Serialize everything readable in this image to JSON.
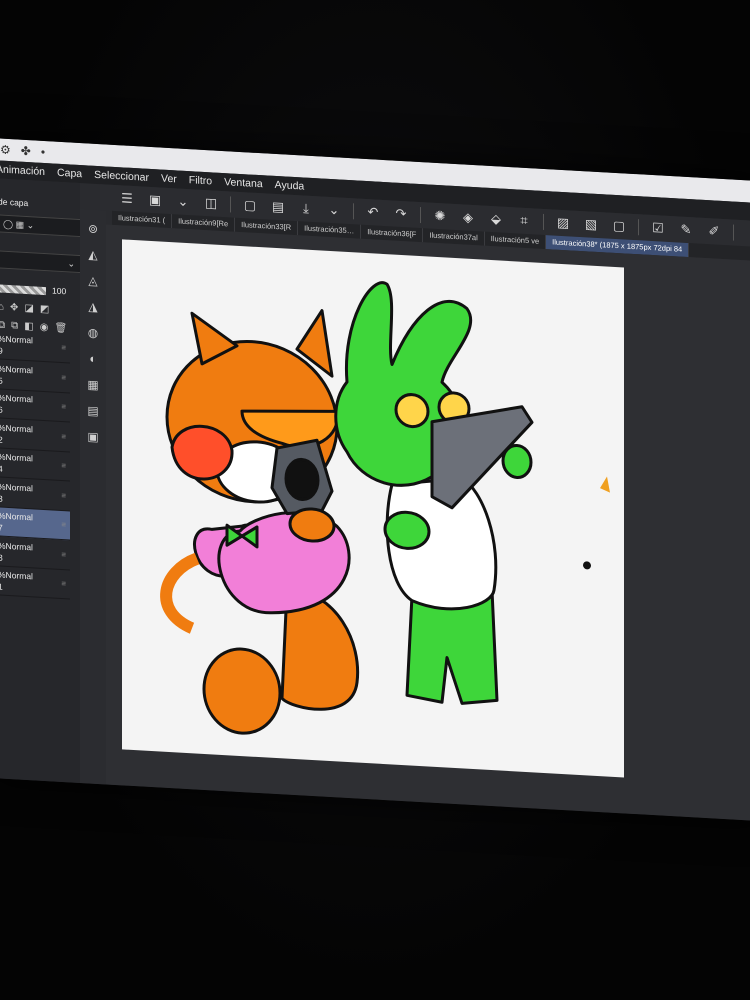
{
  "menu": {
    "items": [
      "Animación",
      "Capa",
      "Seleccionar",
      "Ver",
      "Filtro",
      "Ventana",
      "Ayuda"
    ]
  },
  "tabs": [
    {
      "label": "Ilustración31 ("
    },
    {
      "label": "Ilustración9[Re"
    },
    {
      "label": "Ilustración33[R"
    },
    {
      "label": "Ilustración35…"
    },
    {
      "label": "Ilustración36[F"
    },
    {
      "label": "Ilustración37al"
    },
    {
      "label": "Ilustración5 ve"
    },
    {
      "label": "Ilustración38* (1875 x 1875px 72dpi 84"
    }
  ],
  "layer_panel": {
    "title": "de capa",
    "opacity": "100"
  },
  "layers": [
    {
      "mode": "%Normal",
      "name": "9"
    },
    {
      "mode": "%Normal",
      "name": "5"
    },
    {
      "mode": "%Normal",
      "name": "6"
    },
    {
      "mode": "%Normal",
      "name": "2"
    },
    {
      "mode": "%Normal",
      "name": "4"
    },
    {
      "mode": "%Normal",
      "name": "3"
    },
    {
      "mode": "%Normal",
      "name": "7"
    },
    {
      "mode": "%Normal",
      "name": "8"
    },
    {
      "mode": "%Normal",
      "name": "1"
    }
  ],
  "colors": {
    "accent_selected": "#56678d",
    "active_tab": "#3d4f75",
    "tiger_orange": "#f07c10",
    "bunny_green": "#3ed63a",
    "shirt_pink": "#f27fd8"
  },
  "icons": {
    "toolbar": [
      "menu-icon",
      "select-icon",
      "chevron-down-icon",
      "transform-icon",
      "new-icon",
      "open-icon",
      "save-icon",
      "undo-icon",
      "redo-icon",
      "spinner-icon",
      "fill-icon",
      "crop-icon",
      "pen-icon",
      "brush-icon",
      "tablet-icon"
    ],
    "vertical": [
      "zoom-icon",
      "layer-icon",
      "pen-tool-icon",
      "eraser-icon",
      "color-icon",
      "drop-icon",
      "grid-icon",
      "film-icon",
      "frame-icon"
    ]
  }
}
